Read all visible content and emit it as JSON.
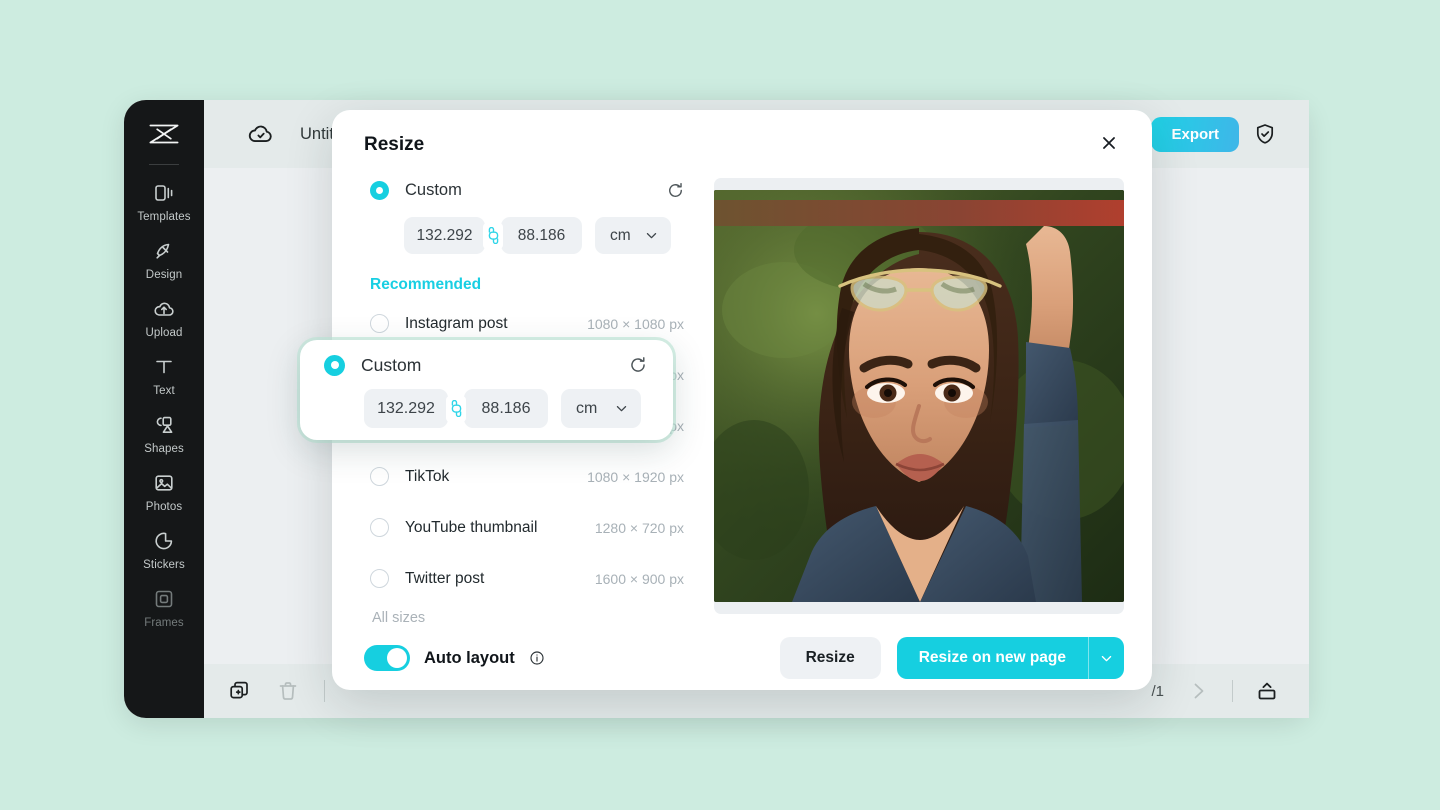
{
  "app": {
    "background_color": "#cdece0",
    "logo_name": "capcut-logo"
  },
  "sidebar": {
    "items": [
      {
        "label": "Templates",
        "icon": "templates-icon"
      },
      {
        "label": "Design",
        "icon": "design-icon"
      },
      {
        "label": "Upload",
        "icon": "upload-icon"
      },
      {
        "label": "Text",
        "icon": "text-icon"
      },
      {
        "label": "Shapes",
        "icon": "shapes-icon"
      },
      {
        "label": "Photos",
        "icon": "photos-icon"
      },
      {
        "label": "Stickers",
        "icon": "stickers-icon"
      },
      {
        "label": "Frames",
        "icon": "frames-icon"
      }
    ]
  },
  "topbar": {
    "cloud_icon": "cloud-saved-icon",
    "doc_title": "Untitled",
    "export_label": "Export",
    "export_color": "#2fc6e4",
    "shield_icon": "shield-check-icon"
  },
  "bottombar": {
    "duplicate_icon": "add-page-icon",
    "delete_icon": "trash-icon",
    "page_indicator": "/1",
    "next_page_icon": "chevron-right-icon",
    "present_icon": "present-icon"
  },
  "dialog": {
    "title": "Resize",
    "close_icon": "close-icon",
    "custom": {
      "label": "Custom",
      "selected": true,
      "reset_icon": "reset-icon",
      "width": "132.292",
      "height": "88.186",
      "link_icon": "link-icon",
      "unit": "cm",
      "unit_caret": "chevron-down-icon"
    },
    "recommended_title": "Recommended",
    "presets": [
      {
        "name": "Instagram post",
        "size": "1080 × 1080 px"
      },
      {
        "name": "",
        "size": "px"
      },
      {
        "name": "",
        "size": "px"
      },
      {
        "name": "TikTok",
        "size": "1080 × 1920 px"
      },
      {
        "name": "YouTube thumbnail",
        "size": "1280 × 720 px"
      },
      {
        "name": "Twitter post",
        "size": "1600 × 900 px"
      }
    ],
    "all_sizes_label": "All sizes",
    "footer": {
      "auto_layout_label": "Auto layout",
      "auto_layout_on": true,
      "info_icon": "info-icon",
      "resize_label": "Resize",
      "resize_new_page_label": "Resize on new page",
      "resize_new_page_caret": "chevron-down-icon",
      "accent_color": "#16cfe0"
    },
    "preview": {
      "image_name": "portrait-photo-woman-sunglasses"
    }
  },
  "popup": {
    "label": "Custom",
    "selected": true,
    "reset_icon": "reset-icon",
    "width": "132.292",
    "height": "88.186",
    "link_icon": "link-icon",
    "unit": "cm",
    "unit_caret": "chevron-down-icon"
  }
}
